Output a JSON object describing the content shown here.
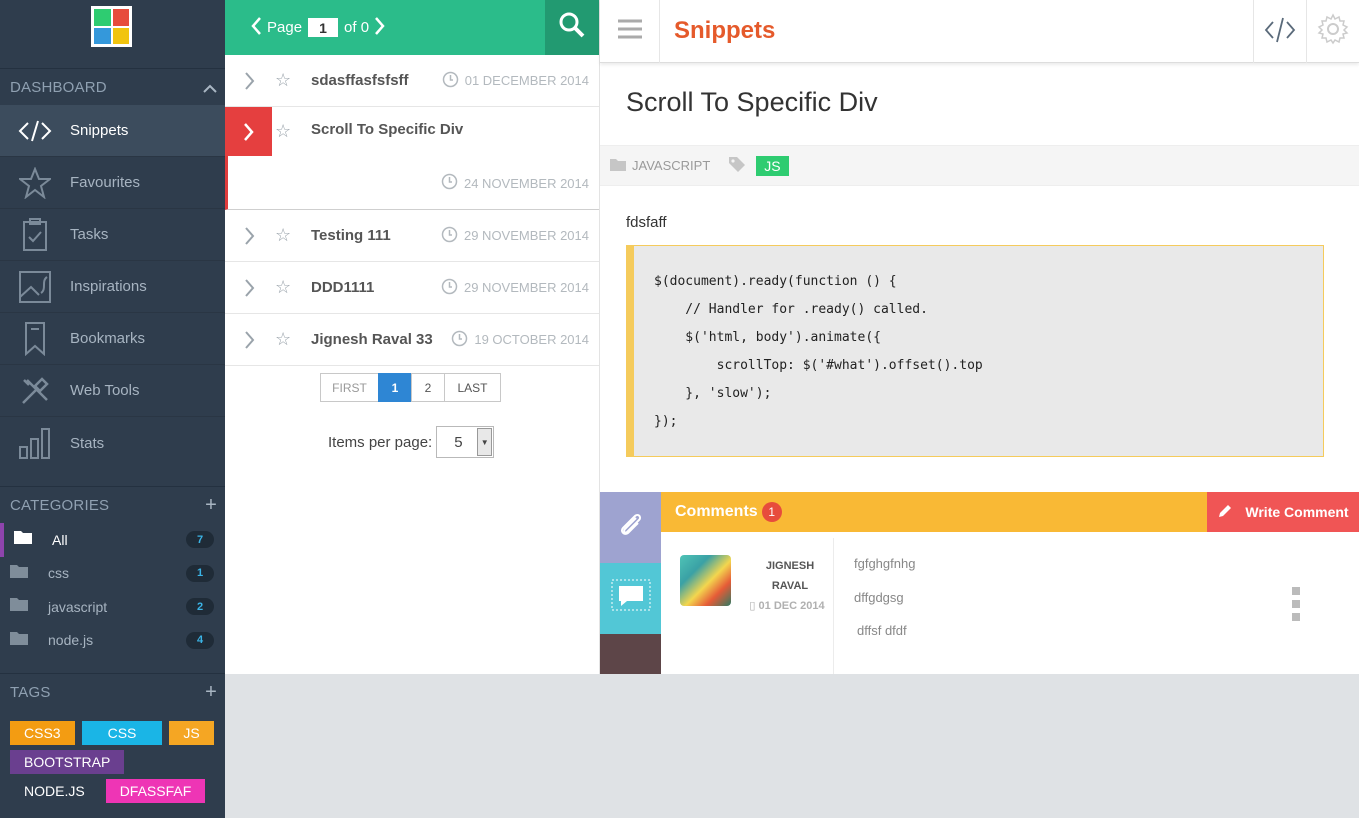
{
  "sidebar": {
    "logo_colors": [
      "#2ecc71",
      "#e74c3c",
      "#3498db",
      "#f1c40f"
    ],
    "dashboard_label": "DASHBOARD",
    "nav": [
      {
        "label": "Snippets",
        "icon": "code-icon",
        "active": true
      },
      {
        "label": "Favourites",
        "icon": "star-icon"
      },
      {
        "label": "Tasks",
        "icon": "clipboard-icon"
      },
      {
        "label": "Inspirations",
        "icon": "image-icon"
      },
      {
        "label": "Bookmarks",
        "icon": "bookmark-icon"
      },
      {
        "label": "Web Tools",
        "icon": "tools-icon"
      },
      {
        "label": "Stats",
        "icon": "stats-icon"
      }
    ],
    "categories_label": "CATEGORIES",
    "categories": [
      {
        "name": "All",
        "count": "7"
      },
      {
        "name": "css",
        "count": "1"
      },
      {
        "name": "javascript",
        "count": "2"
      },
      {
        "name": "node.js",
        "count": "4"
      }
    ],
    "tags_label": "TAGS",
    "tags": [
      {
        "name": "CSS3",
        "color": "#f39c12"
      },
      {
        "name": "CSS",
        "color": "#1ab5e6"
      },
      {
        "name": "JS",
        "color": "#f5a623"
      },
      {
        "name": "BOOTSTRAP",
        "color": "#6a3f8f"
      },
      {
        "name": "NODE.JS",
        "color": "#2f3d4d"
      },
      {
        "name": "DFASSFAF",
        "color": "#ee35b5"
      }
    ]
  },
  "list": {
    "page_label": "Page",
    "page_value": "1",
    "page_of": "of 0",
    "items": [
      {
        "title": "sdasffasfsfsff",
        "date": "01 DECEMBER 2014"
      },
      {
        "title": "Scroll To Specific Div",
        "date": "24 NOVEMBER 2014",
        "selected": true
      },
      {
        "title": "Testing 111",
        "date": "29 NOVEMBER 2014"
      },
      {
        "title": "DDD1111",
        "date": "29 NOVEMBER 2014"
      },
      {
        "title": "Jignesh Raval 33",
        "date": "19 OCTOBER 2014"
      }
    ],
    "pager": {
      "first": "FIRST",
      "p1": "1",
      "p2": "2",
      "last": "LAST"
    },
    "items_per_page_label": "Items per page:",
    "items_per_page": "5"
  },
  "detail": {
    "header_title": "Snippets",
    "title": "Scroll To Specific Div",
    "category": "JAVASCRIPT",
    "tag": "JS",
    "description": "fdsfaff",
    "code": "$(document).ready(function () {\n    // Handler for .ready() called.\n    $('html, body').animate({\n        scrollTop: $('#what').offset().top\n    }, 'slow');\n});",
    "comments": {
      "label": "Comments",
      "count": "1",
      "write_label": "Write Comment",
      "author_first": "JIGNESH",
      "author_last": "RAVAL",
      "date": "01 DEC 2014",
      "lines": [
        "fgfghgfnhg",
        "dffgdgsg",
        "dffsf dfdf"
      ]
    }
  }
}
